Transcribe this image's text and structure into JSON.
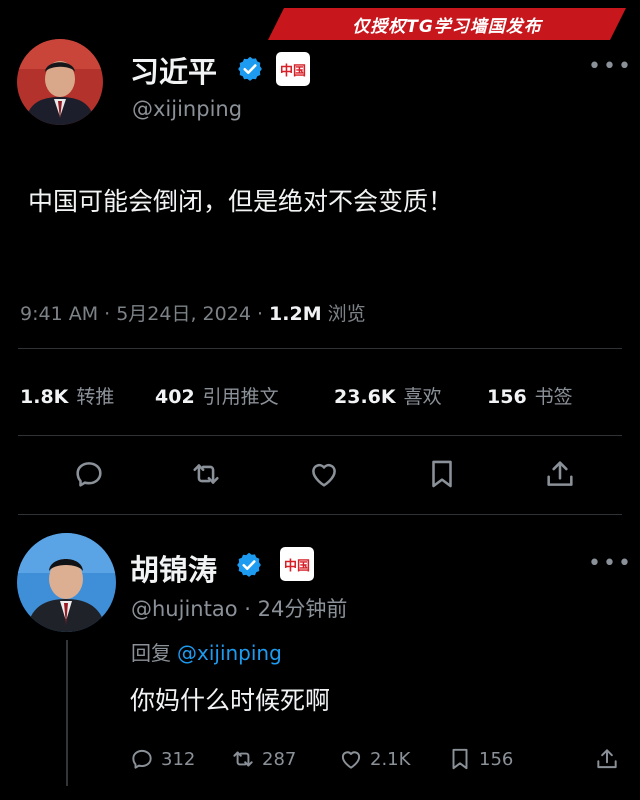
{
  "banner": {
    "text": "仅授权TG学习墙国发布"
  },
  "main_tweet": {
    "author_name": "习近平",
    "handle": "@xijinping",
    "country_badge": "中国",
    "text": "中国可能会倒闭，但是绝对不会变质！",
    "time": "9:41 AM · 5月24日, 2024 ·",
    "views_count": "1.2M",
    "views_label": "浏览",
    "stats": [
      {
        "count": "1.8K",
        "label": "转推"
      },
      {
        "count": "402",
        "label": "引用推文"
      },
      {
        "count": "23.6K",
        "label": "喜欢"
      },
      {
        "count": "156",
        "label": "书签"
      }
    ]
  },
  "reply_tweet": {
    "author_name": "胡锦涛",
    "handle": "@hujintao",
    "time_ago": "· 24分钟前",
    "country_badge": "中国",
    "reply_prefix": "回复",
    "reply_mention": "@xijinping",
    "text": "你妈什么时候死啊",
    "actions": {
      "replies": "312",
      "retweets": "287",
      "likes": "2.1K",
      "bookmarks": "156"
    }
  },
  "colors": {
    "background": "#000000",
    "banner": "#c8161d",
    "verified": "#1d9bf0",
    "mention": "#1d9bf0",
    "muted": "#8b9198"
  }
}
